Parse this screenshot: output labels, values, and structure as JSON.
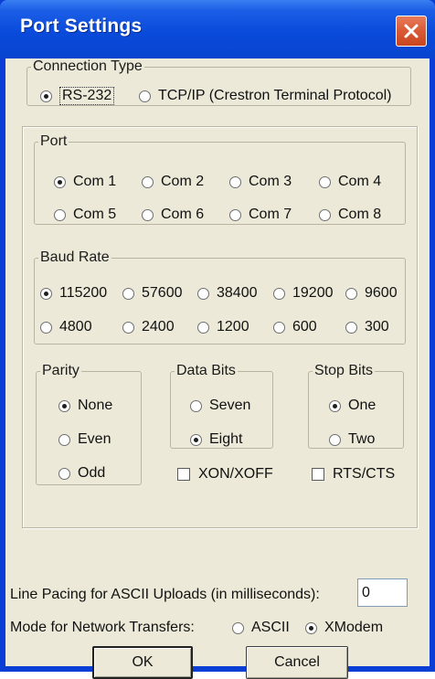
{
  "window": {
    "title": "Port Settings",
    "close_icon": "close-x-icon"
  },
  "connection_type": {
    "legend": "Connection Type",
    "options": [
      {
        "label": "RS-232",
        "selected": true
      },
      {
        "label": "TCP/IP (Crestron Terminal Protocol)",
        "selected": false
      }
    ]
  },
  "port": {
    "legend": "Port",
    "options": [
      {
        "label": "Com 1",
        "selected": true
      },
      {
        "label": "Com 2",
        "selected": false
      },
      {
        "label": "Com 3",
        "selected": false
      },
      {
        "label": "Com 4",
        "selected": false
      },
      {
        "label": "Com 5",
        "selected": false
      },
      {
        "label": "Com 6",
        "selected": false
      },
      {
        "label": "Com 7",
        "selected": false
      },
      {
        "label": "Com 8",
        "selected": false
      }
    ]
  },
  "baud_rate": {
    "legend": "Baud Rate",
    "options": [
      {
        "label": "115200",
        "selected": true
      },
      {
        "label": "57600",
        "selected": false
      },
      {
        "label": "38400",
        "selected": false
      },
      {
        "label": "19200",
        "selected": false
      },
      {
        "label": "9600",
        "selected": false
      },
      {
        "label": "4800",
        "selected": false
      },
      {
        "label": "2400",
        "selected": false
      },
      {
        "label": "1200",
        "selected": false
      },
      {
        "label": "600",
        "selected": false
      },
      {
        "label": "300",
        "selected": false
      }
    ]
  },
  "parity": {
    "legend": "Parity",
    "options": [
      {
        "label": "None",
        "selected": true
      },
      {
        "label": "Even",
        "selected": false
      },
      {
        "label": "Odd",
        "selected": false
      }
    ]
  },
  "data_bits": {
    "legend": "Data Bits",
    "options": [
      {
        "label": "Seven",
        "selected": false
      },
      {
        "label": "Eight",
        "selected": true
      }
    ]
  },
  "stop_bits": {
    "legend": "Stop Bits",
    "options": [
      {
        "label": "One",
        "selected": true
      },
      {
        "label": "Two",
        "selected": false
      }
    ]
  },
  "flow_control": {
    "xon_xoff": {
      "label": "XON/XOFF",
      "checked": false
    },
    "rts_cts": {
      "label": "RTS/CTS",
      "checked": false
    }
  },
  "line_pacing": {
    "label": "Line Pacing for ASCII Uploads (in milliseconds):",
    "value": "0"
  },
  "network_transfers": {
    "label": "Mode for Network Transfers:",
    "options": [
      {
        "label": "ASCII",
        "selected": false
      },
      {
        "label": "XModem",
        "selected": true
      }
    ]
  },
  "buttons": {
    "ok": "OK",
    "cancel": "Cancel"
  }
}
